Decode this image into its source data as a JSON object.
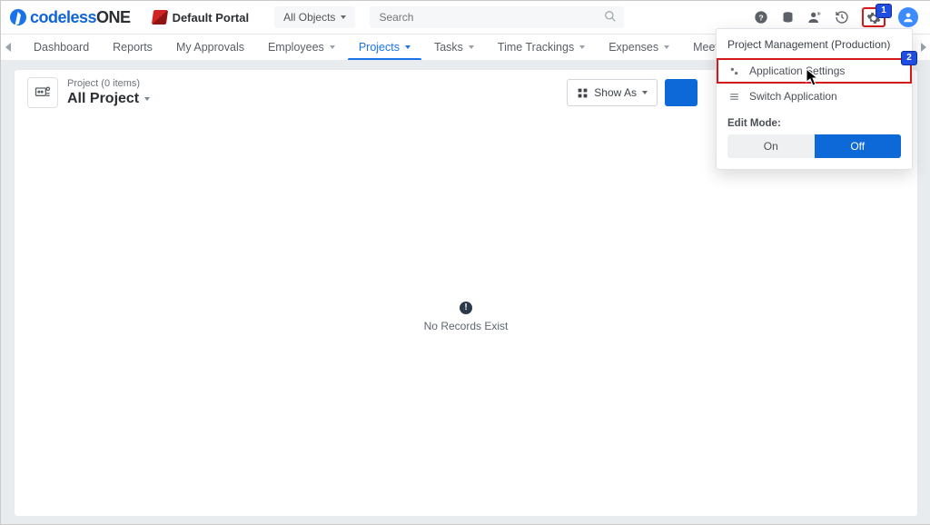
{
  "brand": {
    "part1": "codeless",
    "part2": "ONE"
  },
  "portal_name": "Default Portal",
  "object_filter": {
    "label": "All Objects"
  },
  "search": {
    "placeholder": "Search"
  },
  "nav": {
    "tabs": [
      {
        "label": "Dashboard",
        "has_caret": false
      },
      {
        "label": "Reports",
        "has_caret": false
      },
      {
        "label": "My Approvals",
        "has_caret": false
      },
      {
        "label": "Employees",
        "has_caret": true
      },
      {
        "label": "Projects",
        "has_caret": true,
        "active": true
      },
      {
        "label": "Tasks",
        "has_caret": true
      },
      {
        "label": "Time Trackings",
        "has_caret": true
      },
      {
        "label": "Expenses",
        "has_caret": true
      },
      {
        "label": "Meetings",
        "has_caret": true
      }
    ]
  },
  "content": {
    "subhead": "Project (0 items)",
    "title": "All Project",
    "show_as": "Show As",
    "empty_message": "No Records Exist"
  },
  "menu": {
    "title": "Project Management (Production)",
    "items": [
      {
        "label": "Application Settings",
        "icon": "gears",
        "highlight": true
      },
      {
        "label": "Switch Application",
        "icon": "switch",
        "highlight": false
      }
    ],
    "edit_mode_label": "Edit Mode:",
    "segments": {
      "on": "On",
      "off": "Off",
      "active": "off"
    }
  },
  "annotations": {
    "badge1": "1",
    "badge2": "2"
  }
}
